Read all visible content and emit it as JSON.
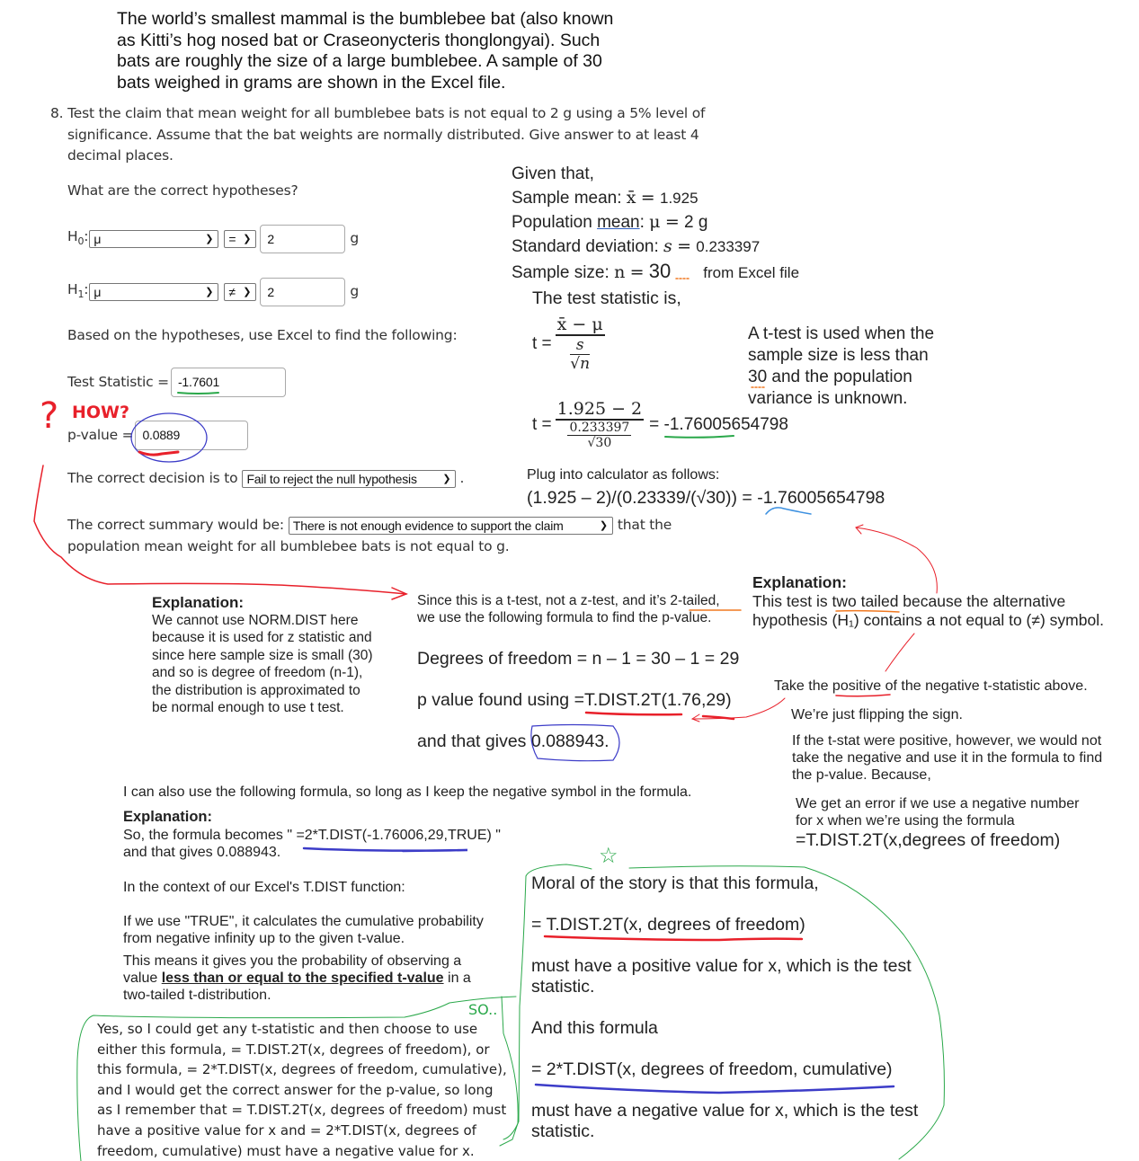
{
  "intro": {
    "lines": [
      "The world’s smallest mammal is the bumblebee bat (also known",
      "as Kitti’s hog nosed bat or Craseonycteris thonglongyai). Such",
      "bats are roughly the size of a large bumblebee. A sample of 30",
      "bats weighed in grams are shown in the Excel file."
    ]
  },
  "question": {
    "number": "8.",
    "line1": "Test the claim that mean weight for all bumblebee bats is not equal to 2 g using a 5% level of",
    "line2": "significance. Assume that the bat weights are normally distributed. Give answer to at least 4",
    "line3": "decimal places.",
    "hypotheses_prompt": "What are the correct hypotheses?",
    "h0": {
      "label": "H",
      "sub": "0",
      "param": "μ",
      "operator": "=",
      "value": "2",
      "unit": "g"
    },
    "h1": {
      "label": "H",
      "sub": "1",
      "param": "μ",
      "operator": "≠",
      "value": "2",
      "unit": "g"
    },
    "excel_prompt": "Based on the hypotheses, use Excel to find the following:",
    "test_stat_label": "Test Statistic =",
    "test_stat_value": "-1.7601",
    "pvalue_label": "p-value =",
    "pvalue_value": "0.0889",
    "decision_label": "The correct decision is to",
    "decision_value": "Fail to reject the null hypothesis",
    "decision_end": ".",
    "summary_label": "The correct summary would be:",
    "summary_value": "There is not enough evidence to support the claim",
    "summary_after": "that the",
    "summary_line2": "population mean weight for all bumblebee bats is not equal to g."
  },
  "annotations": {
    "how": "HOW?",
    "question_mark": "?",
    "so": "SO..",
    "star": "☆"
  },
  "given": {
    "title": "Given that,",
    "mean_label": "Sample mean:",
    "mean_sym": "x̄",
    "mean_val": "1.925",
    "pop_label_a": "Population",
    "pop_label_b": "mean",
    "pop_sym": "μ",
    "pop_val": "2 g",
    "sd_label": "Standard deviation:",
    "sd_sym": "s",
    "sd_val": "0.233397",
    "n_label": "Sample size:",
    "n_sym": "n",
    "n_val": "30",
    "source": "from Excel file"
  },
  "test_stat": {
    "title": "The test statistic is,",
    "t": "t =",
    "formula_num": "x̄ − μ",
    "formula_den_num": "s",
    "formula_den_den": "√n",
    "calc_num": "1.925 − 2",
    "calc_den_num": "0.233397",
    "calc_den_den": "√30",
    "result": "= -1.76005654798",
    "ttest_note": [
      "A t-test is used when the",
      "sample size is less than",
      "30 and the population",
      "variance is unknown."
    ],
    "plug_label": "Plug into calculator as follows:",
    "plug_formula": "(1.925 – 2)/(0.23339/(√30)) = -1.76005654798"
  },
  "left_explanation": {
    "heading": "Explanation:",
    "lines": [
      "We cannot use NORM.DIST here",
      "because it is used for z statistic and",
      "since here sample size is small (30)",
      "and so is degree of freedom (n-1),",
      "the distribution is approximated to",
      "be normal enough to use t test."
    ]
  },
  "middle": {
    "line1": "Since this is a t-test, not a z-test, and it’s 2-tailed,",
    "line2": "we use the following formula to find the p-value.",
    "dof": "Degrees of freedom = n – 1 = 30 – 1 = 29",
    "pval_label": "p value found using",
    "pval_formula": "=T.DIST.2T(1.76,29)",
    "gives_label": "and that gives",
    "gives_value": "0.088943."
  },
  "right_explanation": {
    "heading": "Explanation:",
    "line1": "This test is two tailed because the alternative",
    "line2": "hypothesis (H₁) contains a not equal to (≠) symbol.",
    "take_positive": "Take the positive of the negative t-statistic above.",
    "flip": "We’re just flipping the sign.",
    "if_positive": [
      "If the t-stat were positive, however, we would not",
      "take the negative and use it in the formula to find",
      "the p-value. Because,"
    ],
    "error": [
      "We get an error if we use a negative number",
      "for x when we’re using the formula"
    ],
    "error_formula": "=T.DIST.2T(x,degrees of freedom)"
  },
  "also": {
    "intro": "I can also use the following formula, so long as I keep the negative symbol in the formula.",
    "heading": "Explanation:",
    "formula_line": "So, the formula becomes \" =2*T.DIST(-1.76006,29,TRUE) \"",
    "gives": "and that gives 0.088943.",
    "context": "In the context of our Excel's T.DIST function:",
    "true_line1": "If we use \"TRUE\", it calculates the cumulative probability",
    "true_line2": "from negative infinity up to the given t-value.",
    "means_line1": "This means it gives you the probability of observing a",
    "means_line2a": "value",
    "means_line2b": "less than or equal to the specified t-value",
    "means_line2c": "in a",
    "means_line3": "two-tailed t-distribution."
  },
  "moral": {
    "line1": "Moral of the story is that this formula,",
    "formula1": "= T.DIST.2T(x, degrees of freedom)",
    "pos_line1": "must have a positive value for x, which is the test",
    "pos_line2": "statistic.",
    "and_line": "And this formula",
    "formula2": "= 2*T.DIST(x, degrees of freedom, cumulative)",
    "neg_line1": "must have a negative value for x, which is the test",
    "neg_line2": "statistic."
  },
  "conclusion": {
    "lines": [
      "Yes, so I could get any t-statistic and then choose to use",
      "either this formula, = T.DIST.2T(x, degrees of freedom), or",
      "this formula, = 2*T.DIST(x, degrees of freedom, cumulative),",
      "and I would get the correct answer for the p-value, so long",
      "as I remember that = T.DIST.2T(x, degrees of freedom) must",
      "have a positive value for x and = 2*T.DIST(x, degrees of",
      "freedom, cumulative) must have a negative value for x."
    ]
  },
  "colors": {
    "ink_red": "#e8202a",
    "ink_blue": "#3c3cc8",
    "ink_green": "#2aa84a",
    "ink_orange": "#f07820"
  }
}
